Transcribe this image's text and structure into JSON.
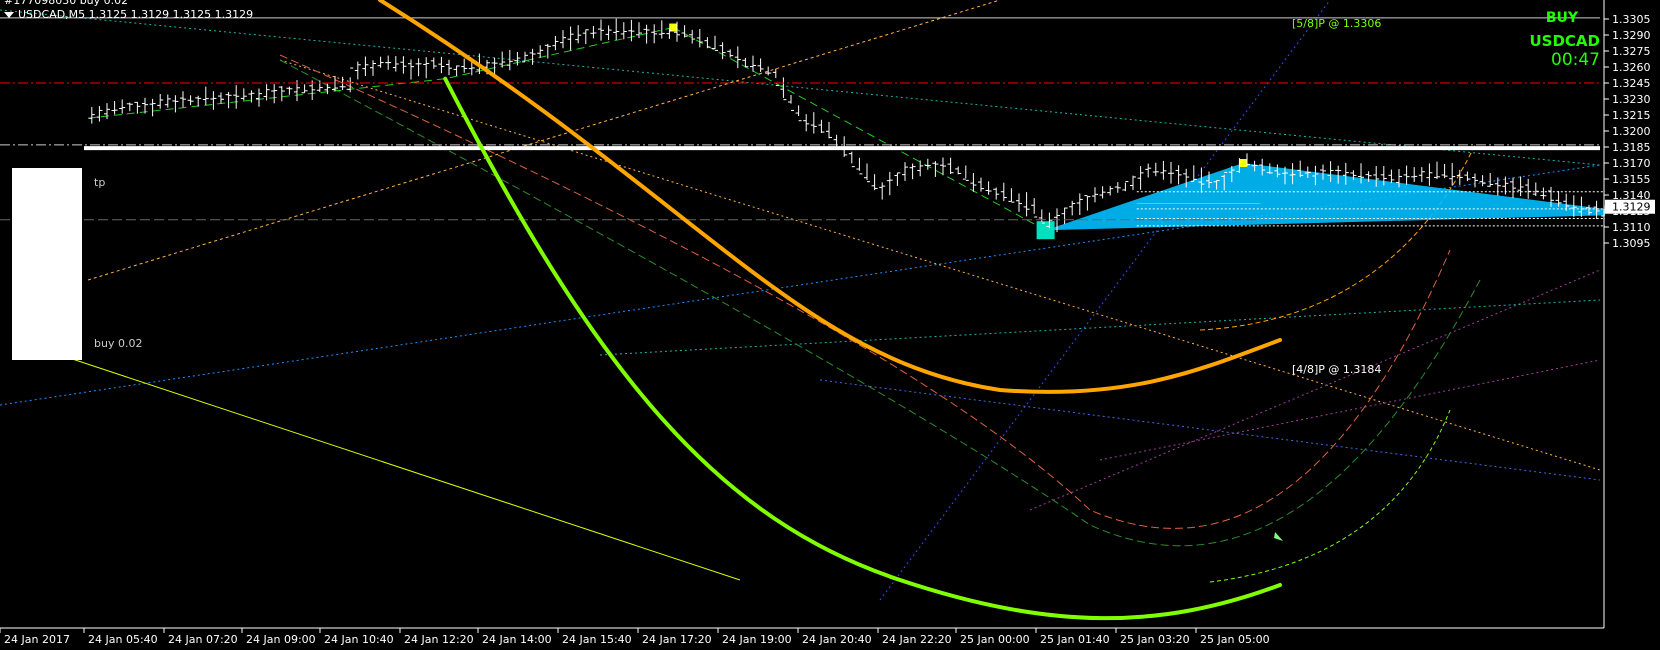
{
  "header": {
    "line1": "#177098030 buy 0.02",
    "symbol_info": "USDCAD,M5  1.3125 1.3129 1.3125 1.3129"
  },
  "signal": {
    "direction": "BUY",
    "symbol": "USDCAD",
    "timer": "00:47"
  },
  "labels": {
    "tp": "tp",
    "buy": "buy 0.02",
    "murrey_58": "[5/8]P @ 1.3306",
    "murrey_48": "[4/8]P @ 1.3184"
  },
  "colors": {
    "background": "#000000",
    "candles": "#ffffff",
    "green_arc": "#7fff00",
    "orange_arc": "#ffa500",
    "pattern_fill": "#00bfff",
    "tp_line": "#ff0000"
  },
  "chart_data": {
    "type": "candlestick",
    "symbol": "USDCAD",
    "timeframe": "M5",
    "current_price": 1.3129,
    "ylim": [
      1.309,
      1.331
    ],
    "y_ticks": [
      1.3305,
      1.329,
      1.3275,
      1.326,
      1.3245,
      1.323,
      1.3215,
      1.32,
      1.3185,
      1.317,
      1.3155,
      1.314,
      1.3125,
      1.311,
      1.3095
    ],
    "x_ticks": [
      "24 Jan 2017",
      "24 Jan 05:40",
      "24 Jan 07:20",
      "24 Jan 09:00",
      "24 Jan 10:40",
      "24 Jan 12:20",
      "24 Jan 14:00",
      "24 Jan 15:40",
      "24 Jan 17:20",
      "24 Jan 19:00",
      "24 Jan 20:40",
      "24 Jan 22:20",
      "25 Jan 00:00",
      "25 Jan 01:40",
      "25 Jan 03:20",
      "25 Jan 05:00"
    ],
    "price_path": [
      [
        0,
        1.3215
      ],
      [
        5,
        1.3222
      ],
      [
        10,
        1.3228
      ],
      [
        15,
        1.323
      ],
      [
        20,
        1.3232
      ],
      [
        25,
        1.3238
      ],
      [
        30,
        1.324
      ],
      [
        34,
        1.3243
      ],
      [
        35,
        1.3258
      ],
      [
        38,
        1.3265
      ],
      [
        42,
        1.326
      ],
      [
        45,
        1.3262
      ],
      [
        48,
        1.3258
      ],
      [
        52,
        1.3262
      ],
      [
        55,
        1.3265
      ],
      [
        58,
        1.327
      ],
      [
        62,
        1.3285
      ],
      [
        66,
        1.3293
      ],
      [
        70,
        1.3294
      ],
      [
        74,
        1.3293
      ],
      [
        78,
        1.3292
      ],
      [
        81,
        1.3285
      ],
      [
        84,
        1.3272
      ],
      [
        87,
        1.3262
      ],
      [
        90,
        1.3255
      ],
      [
        92,
        1.323
      ],
      [
        94,
        1.321
      ],
      [
        97,
        1.32
      ],
      [
        99,
        1.3185
      ],
      [
        102,
        1.316
      ],
      [
        104,
        1.3145
      ],
      [
        108,
        1.3165
      ],
      [
        112,
        1.317
      ],
      [
        116,
        1.3155
      ],
      [
        120,
        1.314
      ],
      [
        124,
        1.3128
      ],
      [
        126,
        1.3112
      ],
      [
        128,
        1.3122
      ],
      [
        132,
        1.314
      ],
      [
        136,
        1.3148
      ],
      [
        140,
        1.3165
      ],
      [
        144,
        1.3158
      ],
      [
        148,
        1.315
      ],
      [
        152,
        1.317
      ],
      [
        156,
        1.3162
      ],
      [
        160,
        1.316
      ],
      [
        164,
        1.3162
      ],
      [
        168,
        1.3158
      ],
      [
        172,
        1.3155
      ],
      [
        176,
        1.316
      ],
      [
        180,
        1.3158
      ],
      [
        184,
        1.3152
      ],
      [
        188,
        1.3148
      ],
      [
        192,
        1.314
      ],
      [
        196,
        1.3128
      ],
      [
        200,
        1.3122
      ],
      [
        204,
        1.313
      ],
      [
        208,
        1.3136
      ],
      [
        212,
        1.3132
      ],
      [
        216,
        1.3128
      ],
      [
        219,
        1.3129
      ]
    ],
    "levels": [
      {
        "price": 1.3306,
        "label": "[5/8]P @ 1.3306",
        "style": "solid",
        "color": "#cccccc"
      },
      {
        "price": 1.3245,
        "label": "tp",
        "style": "dashdot",
        "color": "#ff0000"
      },
      {
        "price": 1.3187,
        "label": "buy 0.02",
        "style": "dashdot",
        "color": "#cccccc"
      },
      {
        "price": 1.3184,
        "label": "[4/8]P @ 1.3184",
        "style": "solid",
        "color": "#ffffff"
      }
    ],
    "pattern_points": [
      {
        "bar": 126,
        "price": 1.3107
      },
      {
        "bar": 152,
        "price": 1.317
      },
      {
        "bar": 205,
        "price": 1.3122
      }
    ],
    "swing_points": [
      {
        "bar": 0,
        "price": 1.3212
      },
      {
        "bar": 47,
        "price": 1.3249
      },
      {
        "bar": 77,
        "price": 1.3297
      }
    ]
  }
}
